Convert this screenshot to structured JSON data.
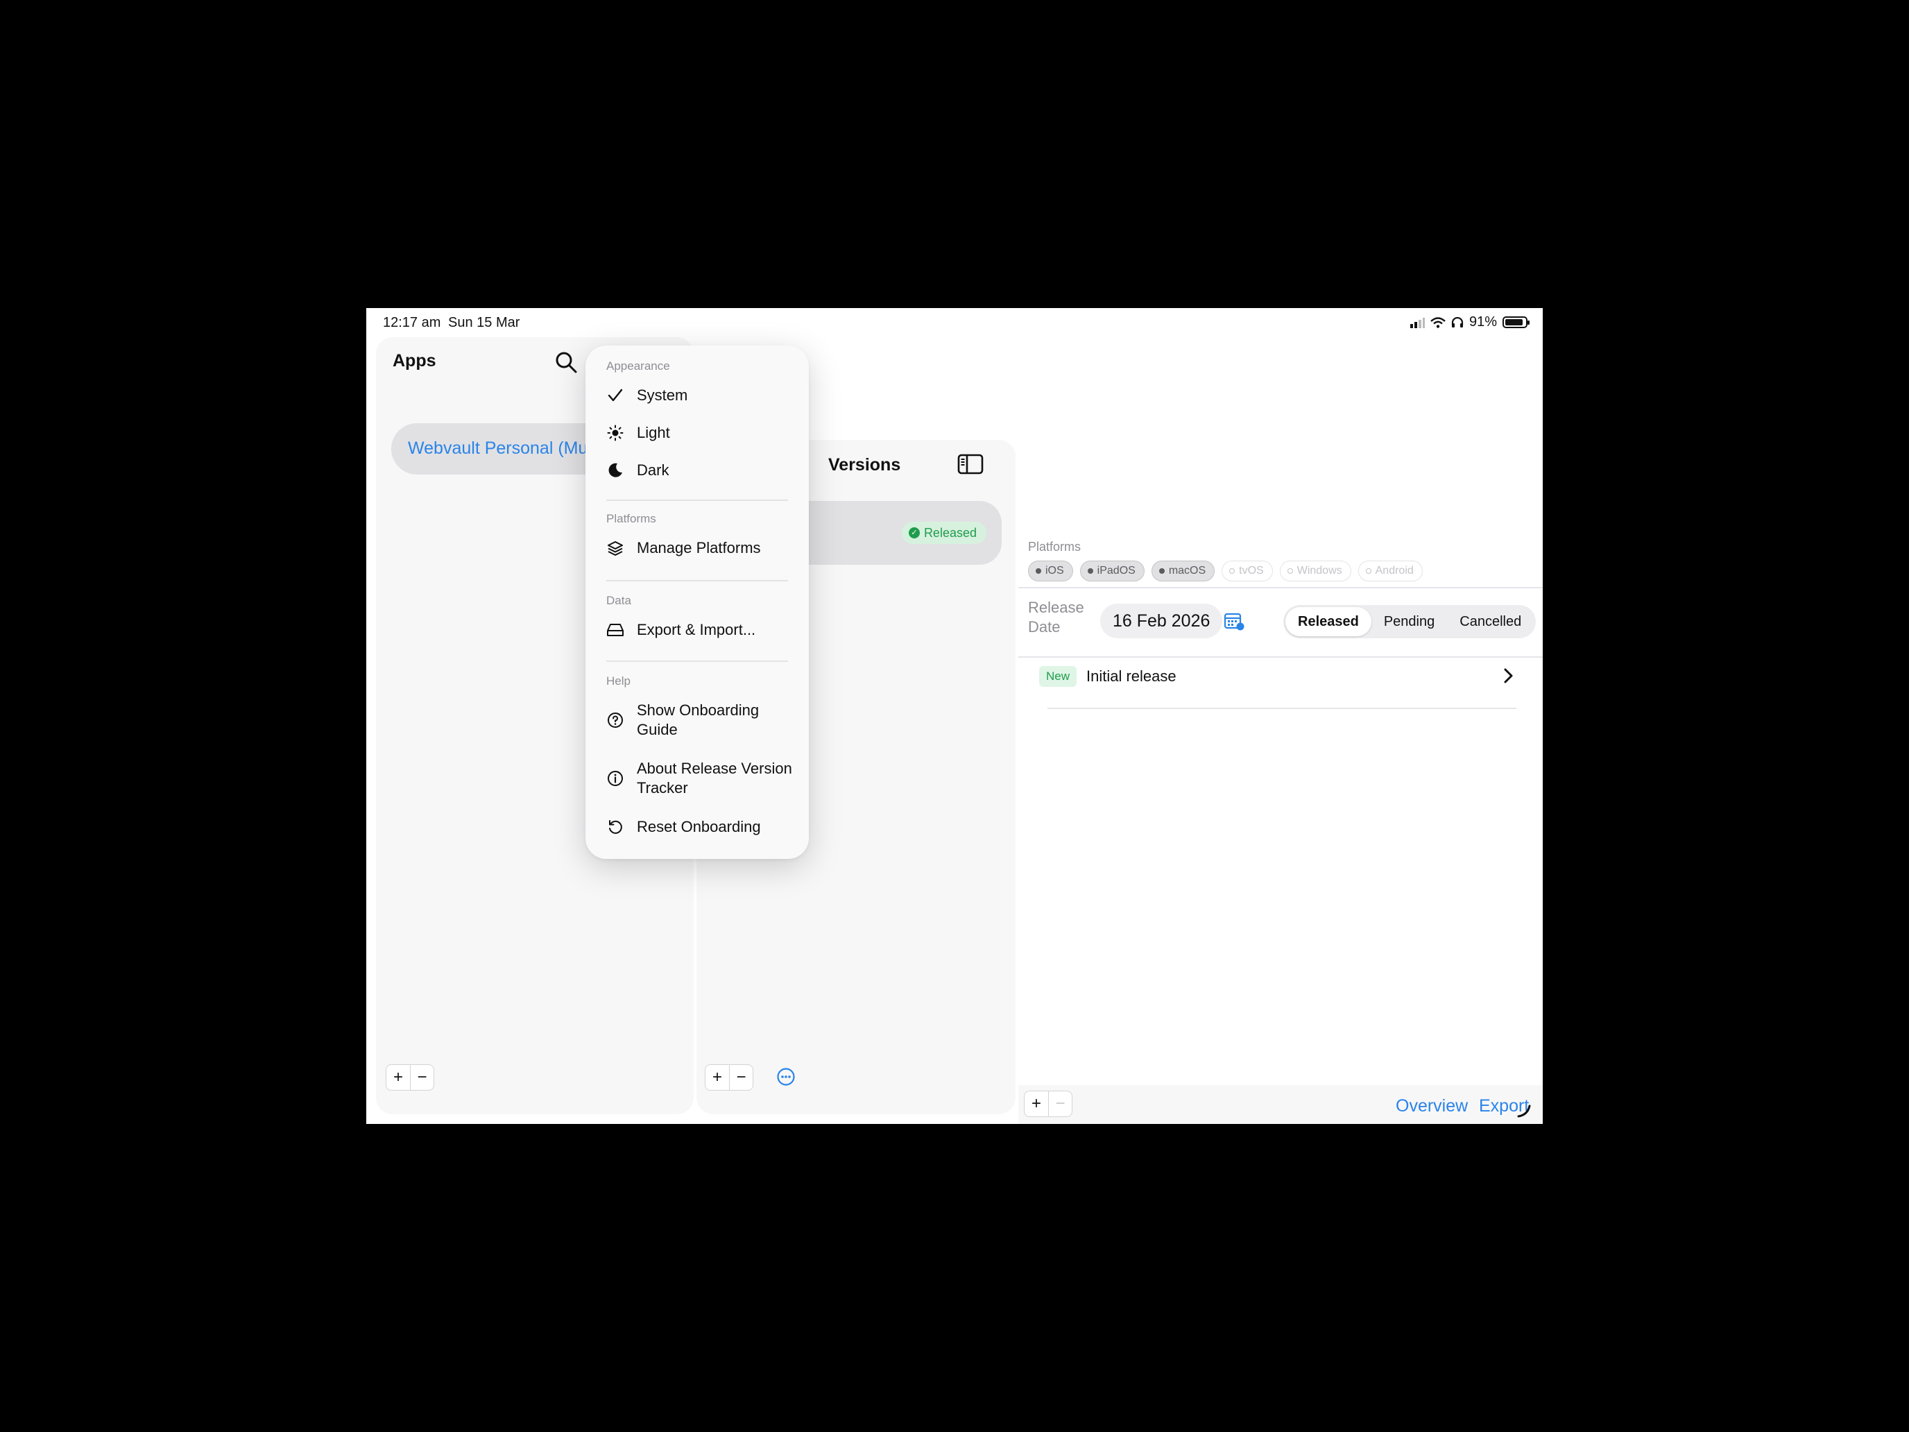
{
  "status_bar": {
    "time": "12:17 am",
    "date": "Sun 15 Mar",
    "battery": "91%",
    "battery_level": 0.91
  },
  "apps": {
    "title": "Apps",
    "selected_app": "Webvault Personal (Mu",
    "add": "+",
    "remove": "−"
  },
  "versions": {
    "title": "Versions",
    "row_status": "Released",
    "add": "+",
    "remove": "−"
  },
  "detail": {
    "platforms_label": "Platforms",
    "platforms": [
      {
        "name": "iOS",
        "enabled": true
      },
      {
        "name": "iPadOS",
        "enabled": true
      },
      {
        "name": "macOS",
        "enabled": true
      },
      {
        "name": "tvOS",
        "enabled": false
      },
      {
        "name": "Windows",
        "enabled": false
      },
      {
        "name": "Android",
        "enabled": false
      }
    ],
    "release_date_label": "Release Date",
    "release_date": "16 Feb 2026",
    "status_options": [
      "Released",
      "Pending",
      "Cancelled"
    ],
    "selected_status": "Released",
    "changes": [
      {
        "badge": "New",
        "text": "Initial release"
      }
    ],
    "footer": {
      "add": "+",
      "remove": "−",
      "overview": "Overview",
      "export": "Export"
    }
  },
  "menu": {
    "sections": {
      "appearance": "Appearance",
      "platforms": "Platforms",
      "data": "Data",
      "help": "Help"
    },
    "appearance_items": [
      {
        "label": "System",
        "icon": "checkmark-icon",
        "selected": true
      },
      {
        "label": "Light",
        "icon": "sun-icon",
        "selected": false
      },
      {
        "label": "Dark",
        "icon": "moon-icon",
        "selected": false
      }
    ],
    "manage_platforms": "Manage Platforms",
    "export_import": "Export & Import...",
    "show_onboarding": "Show Onboarding Guide",
    "about": "About Release Version Tracker",
    "reset_onboarding": "Reset Onboarding"
  },
  "colors": {
    "accent": "#2a84e8",
    "success": "#1f9d4c",
    "success_bg": "#d7f1df"
  }
}
